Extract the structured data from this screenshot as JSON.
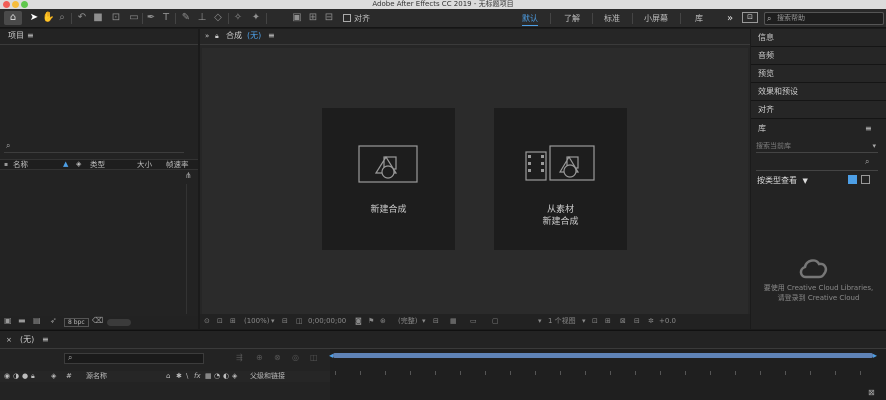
{
  "window": {
    "title": "Adobe After Effects CC 2019 - 无标题项目"
  },
  "toolbar": {
    "align_label": "对齐",
    "workspaces": [
      "默认",
      "了解",
      "标准",
      "小屏幕",
      "库"
    ],
    "active_workspace": "默认",
    "more_glyph": "»",
    "search_placeholder": "搜索帮助"
  },
  "project": {
    "title": "项目",
    "menu_glyph": "≡",
    "columns": [
      "名称",
      "类型",
      "大小",
      "帧速率"
    ],
    "bpc": "8 bpc"
  },
  "composition": {
    "tab_title": "合成",
    "tab_name": "(无)",
    "menu_glyph": "≡",
    "new_comp_label": "新建合成",
    "from_footage_line1": "从素材",
    "from_footage_line2": "新建合成",
    "footer": {
      "zoom": "(100%)",
      "timecode": "0;00;00;00",
      "resolution": "(完整)",
      "views": "1 个视图",
      "exposure": "+0.0"
    }
  },
  "right_panel": {
    "items": [
      "信息",
      "音频",
      "预览",
      "效果和预设",
      "对齐"
    ],
    "library_title": "库",
    "library_menu_glyph": "≡",
    "library_search_placeholder": "搜索当前库",
    "view_by_type": "按类型查看",
    "cc_message_line1": "要使用 Creative Cloud Libraries,",
    "cc_message_line2": "请登录到 Creative Cloud"
  },
  "timeline": {
    "tab_name": "(无)",
    "menu_glyph": "≡",
    "columns": {
      "hash": "#",
      "source_name": "源名称",
      "parent": "父级和链接"
    }
  },
  "colors": {
    "accent": "#4d9fe6",
    "panel_bg": "#232323",
    "card_bg": "#1d1d1d"
  }
}
